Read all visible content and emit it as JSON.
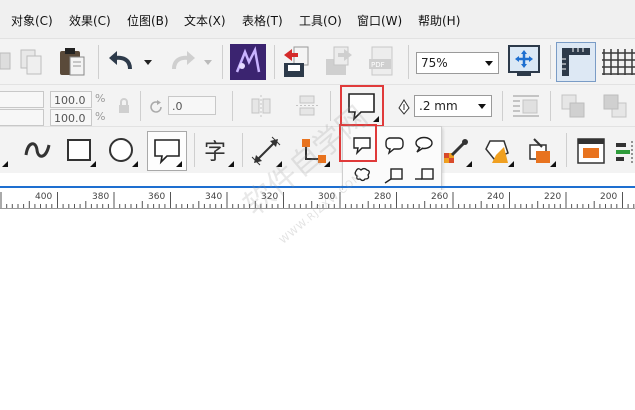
{
  "menu": {
    "items": [
      {
        "label": "对象(C)",
        "key": "object"
      },
      {
        "label": "效果(C)",
        "key": "effects"
      },
      {
        "label": "位图(B)",
        "key": "bitmaps"
      },
      {
        "label": "文本(X)",
        "key": "text"
      },
      {
        "label": "表格(T)",
        "key": "table"
      },
      {
        "label": "工具(O)",
        "key": "tools"
      },
      {
        "label": "窗口(W)",
        "key": "window"
      },
      {
        "label": "帮助(H)",
        "key": "help"
      }
    ]
  },
  "toolbar": {
    "zoom_value": "75%"
  },
  "property_bar": {
    "scale_x": "100.0",
    "scale_y": "100.0",
    "pct_x": "%",
    "pct_y": "%",
    "rotation": ".0",
    "outline_width": ".2 mm"
  },
  "ruler": {
    "ticks": [
      "400",
      "380",
      "360",
      "340",
      "320",
      "300",
      "280",
      "260",
      "240",
      "220",
      "200"
    ]
  },
  "watermark": {
    "text": "软件自学网",
    "url": "WWW.RJZXW.COM"
  },
  "colors": {
    "highlight": "#e03a3a",
    "accent_blue": "#1e6fd0",
    "ruler_line": "#1e6fd0"
  }
}
